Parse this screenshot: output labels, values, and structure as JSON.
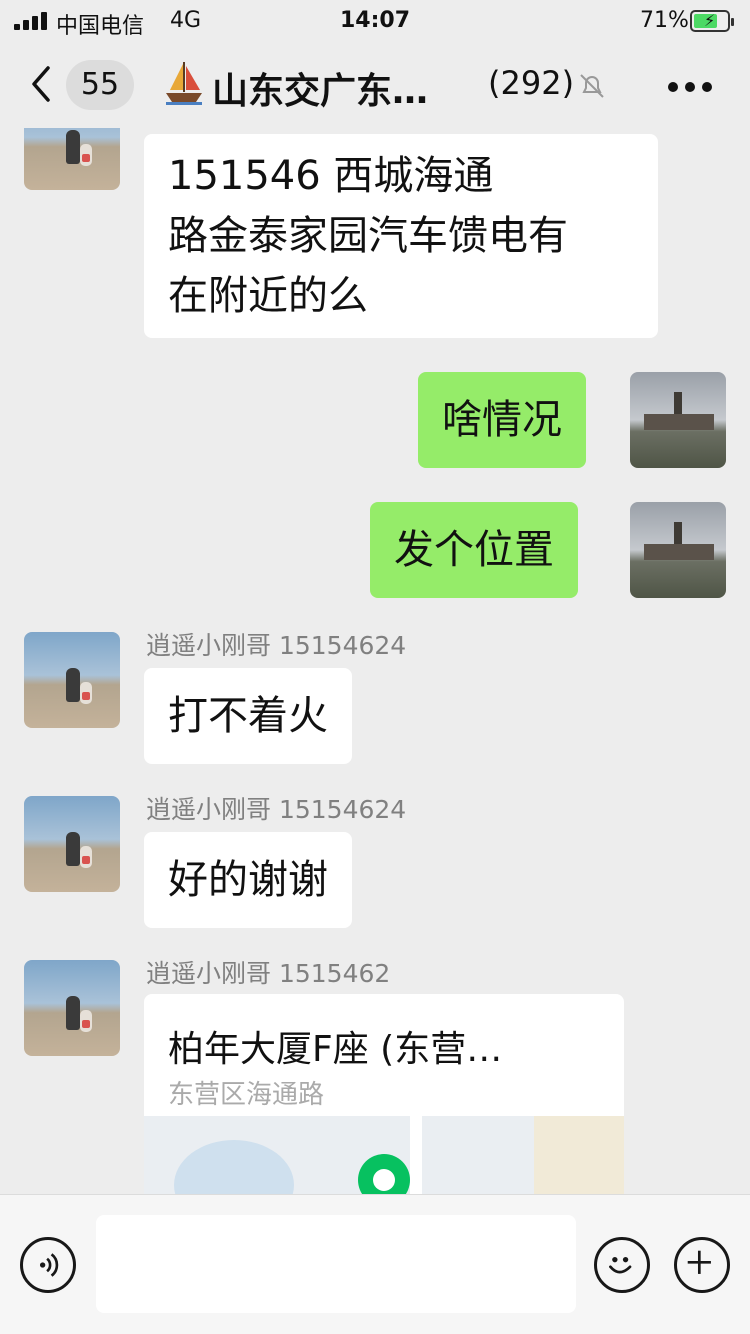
{
  "status_bar": {
    "carrier": "中国电信",
    "network": "4G",
    "time": "14:07",
    "battery": "71%",
    "battery_level": 0.71
  },
  "header": {
    "back_count": "55",
    "title": "山东交广东…",
    "member_count": "(292)",
    "icons": [
      "back-icon",
      "boat-icon",
      "mute-icon",
      "more-icon"
    ]
  },
  "messages": [
    {
      "side": "left",
      "sender": "",
      "text": "151546        西城海通路金泰家园汽车馈电有在附近的么",
      "lines": [
        "151546        西城海通",
        "路金泰家园汽车馈电有",
        "在附近的么"
      ]
    },
    {
      "side": "right",
      "text": "啥情况"
    },
    {
      "side": "right",
      "text": "发个位置"
    },
    {
      "side": "left",
      "sender": "逍遥小刚哥 15154624",
      "text": "打不着火"
    },
    {
      "side": "left",
      "sender": "逍遥小刚哥 15154624",
      "text": "好的谢谢"
    },
    {
      "side": "left",
      "sender": "逍遥小刚哥 1515462",
      "type": "location",
      "name": "柏年大厦F座 (东营…",
      "address": "东营区海通路"
    }
  ],
  "input_bar": {
    "placeholder": "",
    "icons": [
      "voice-icon",
      "emoji-icon",
      "plus-icon"
    ]
  },
  "colors": {
    "background": "#ededed",
    "bubble_white": "#ffffff",
    "bubble_green": "#95ec69",
    "map_pin": "#07c160"
  }
}
